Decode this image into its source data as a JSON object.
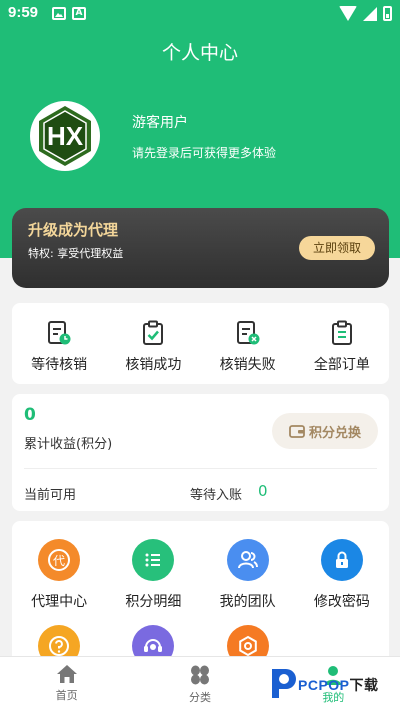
{
  "status_bar": {
    "time": "9:59"
  },
  "header": {
    "title": "个人中心",
    "username": "游客用户",
    "login_hint": "请先登录后可获得更多体验",
    "avatar_text": "HX"
  },
  "vip": {
    "title": "升级成为代理",
    "subtitle": "特权: 享受代理权益",
    "button": "立即领取"
  },
  "orders": [
    {
      "label": "等待核销",
      "icon": "clipboard-clock-icon"
    },
    {
      "label": "核销成功",
      "icon": "clipboard-check-icon"
    },
    {
      "label": "核销失败",
      "icon": "clipboard-x-icon"
    },
    {
      "label": "全部订单",
      "icon": "clipboard-list-icon"
    }
  ],
  "points": {
    "value": "0",
    "label": "累计收益(积分)",
    "exchange_button": "积分兑换",
    "available_label": "当前可用",
    "pending_label": "等待入账",
    "pending_value": "0"
  },
  "tools": [
    {
      "label": "代理中心",
      "icon": "agent-icon",
      "color": "#f48a2a",
      "glyph": "代"
    },
    {
      "label": "积分明细",
      "icon": "list-icon",
      "color": "#27c07b"
    },
    {
      "label": "我的团队",
      "icon": "team-icon",
      "color": "#4a8ef0"
    },
    {
      "label": "修改密码",
      "icon": "lock-icon",
      "color": "#1b87e5"
    }
  ],
  "tools_row2": [
    {
      "icon": "help-icon",
      "color": "#f5a623"
    },
    {
      "icon": "service-icon",
      "color": "#7a6ae0"
    },
    {
      "icon": "settings-icon",
      "color": "#f57a23"
    }
  ],
  "tabbar": [
    {
      "label": "首页",
      "icon": "home-icon"
    },
    {
      "label": "分类",
      "icon": "category-icon"
    },
    {
      "label": "我的",
      "icon": "profile-icon"
    }
  ],
  "watermark": {
    "text_blue": "PCPOP",
    "text_black": "下载"
  },
  "colors": {
    "primary": "#1fbd77",
    "vip_gold": "#f6d79a",
    "dark_card": "#3a3a3a"
  }
}
